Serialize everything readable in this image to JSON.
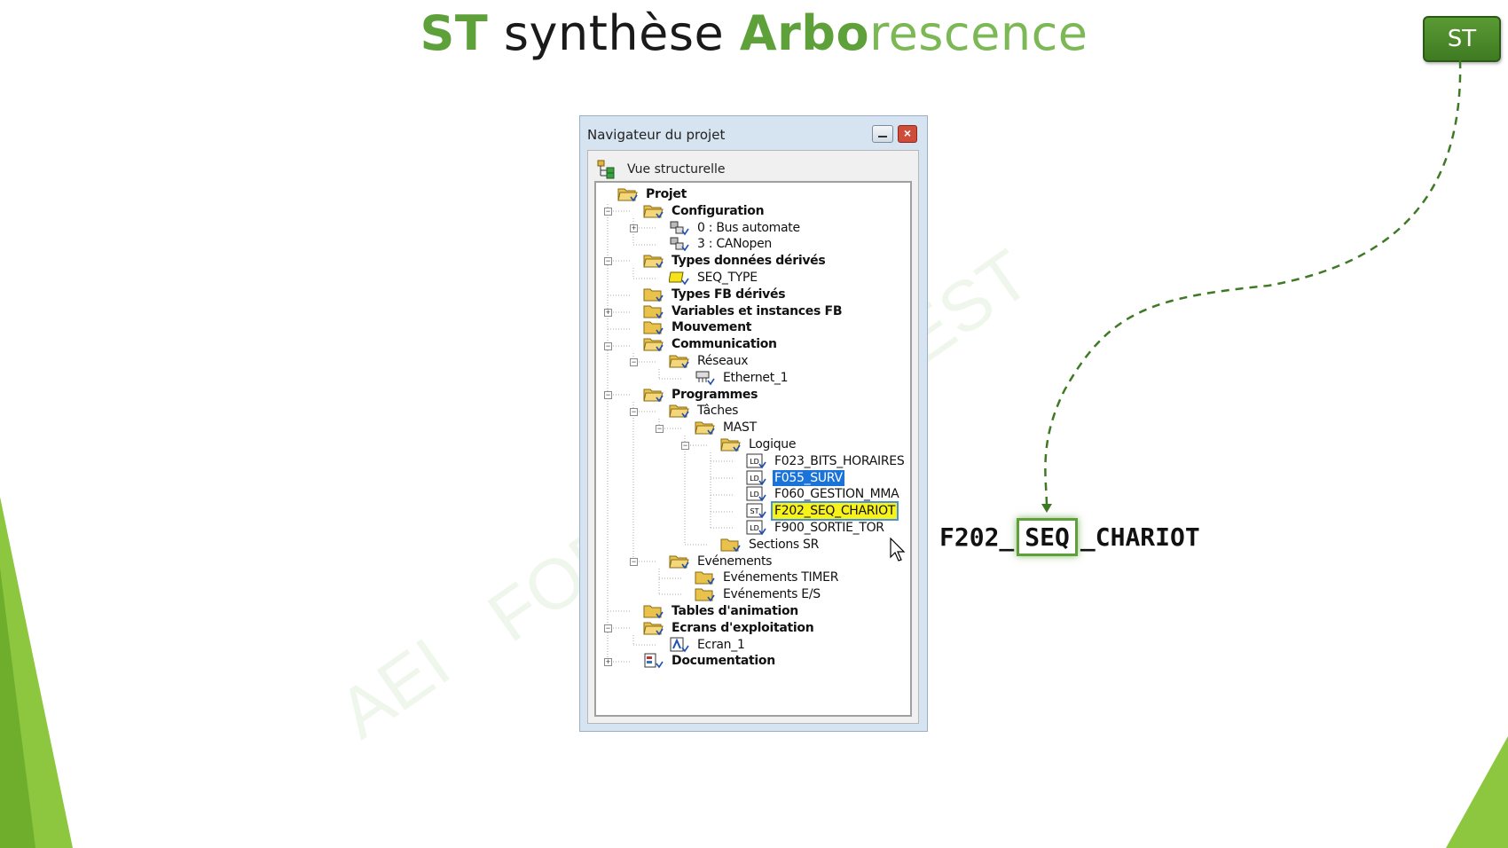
{
  "slide": {
    "title_st": "ST",
    "title_synthese": "synthèse",
    "title_arbo_bold": "Arbo",
    "title_arbo_rest": "rescence",
    "badge": "ST",
    "watermarks": [
      "AEI",
      "FOR",
      "EST"
    ]
  },
  "window": {
    "title": "Navigateur du projet",
    "close_glyph": "×",
    "view_label": "Vue structurelle"
  },
  "tree": [
    {
      "label": "Projet",
      "icon": "folder-open-icon"
    },
    {
      "label": "Configuration",
      "icon": "folder-open-icon"
    },
    {
      "label": "0 : Bus automate",
      "icon": "bus-icon"
    },
    {
      "label": "3 : CANopen",
      "icon": "bus-icon"
    },
    {
      "label": "Types données dérivés",
      "icon": "folder-open-icon"
    },
    {
      "label": "SEQ_TYPE",
      "icon": "type-icon"
    },
    {
      "label": "Types FB dérivés",
      "icon": "folder-icon"
    },
    {
      "label": "Variables et instances FB",
      "icon": "folder-icon"
    },
    {
      "label": "Mouvement",
      "icon": "folder-icon"
    },
    {
      "label": "Communication",
      "icon": "folder-open-icon"
    },
    {
      "label": "Réseaux",
      "icon": "folder-open-icon"
    },
    {
      "label": "Ethernet_1",
      "icon": "network-icon"
    },
    {
      "label": "Programmes",
      "icon": "folder-open-icon"
    },
    {
      "label": "Tâches",
      "icon": "folder-open-icon"
    },
    {
      "label": "MAST",
      "icon": "folder-open-icon"
    },
    {
      "label": "Logique",
      "icon": "folder-open-icon"
    },
    {
      "label": "F023_BITS_HORAIRES",
      "icon": "ld-section-icon"
    },
    {
      "label": "F055_SURV",
      "icon": "ld-section-icon"
    },
    {
      "label": "F060_GESTION_MMA",
      "icon": "ld-section-icon"
    },
    {
      "label": "F202_SEQ_CHARIOT",
      "icon": "st-section-icon"
    },
    {
      "label": "F900_SORTIE_TOR",
      "icon": "ld-section-icon"
    },
    {
      "label": "Sections SR",
      "icon": "folder-icon"
    },
    {
      "label": "Evénements",
      "icon": "folder-open-icon"
    },
    {
      "label": "Evénements TIMER",
      "icon": "folder-icon"
    },
    {
      "label": "Evénements E/S",
      "icon": "folder-icon"
    },
    {
      "label": "Tables d'animation",
      "icon": "folder-icon"
    },
    {
      "label": "Ecrans d'exploitation",
      "icon": "folder-open-icon"
    },
    {
      "label": "Ecran_1",
      "icon": "screen-icon"
    },
    {
      "label": "Documentation",
      "icon": "documentation-icon"
    }
  ],
  "section_icon_text": {
    "ld": "LD",
    "st": "ST"
  },
  "expander_glyphs": {
    "minus": "−",
    "plus": "+"
  },
  "callout": {
    "prefix": "F202_",
    "highlight": "SEQ",
    "suffix": "_CHARIOT"
  },
  "colors": {
    "accent_green": "#5ea03a",
    "selection_blue": "#1a73d9",
    "selection_yellow": "#f7f21a"
  }
}
